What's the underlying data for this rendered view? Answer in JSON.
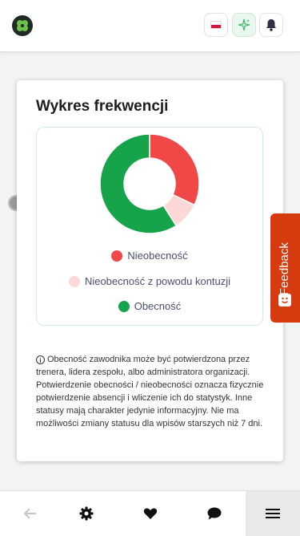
{
  "header": {
    "logo_icon": "clover-logo-icon",
    "language_icon": "poland-flag-icon",
    "ai_icon": "sparkles-icon",
    "notifications_icon": "bell-icon"
  },
  "card": {
    "title": "Wykres frekwencji",
    "chart_data": {
      "type": "pie",
      "title": "",
      "slices": [
        {
          "name": "Nieobecność",
          "value": 32,
          "color": "#f04747"
        },
        {
          "name": "Nieobecność z powodu kontuzji",
          "value": 9,
          "color": "#fcd9d6"
        },
        {
          "name": "Obecność",
          "value": 59,
          "color": "#17a34a"
        }
      ],
      "legend_position": "bottom"
    },
    "legend": [
      {
        "label": "Nieobecność",
        "color": "#f04747"
      },
      {
        "label": "Nieobecność z powodu kontuzji",
        "color": "#fcd9d6"
      },
      {
        "label": "Obecność",
        "color": "#17a34a"
      }
    ],
    "info_text": "Obecność zawodnika może być potwierdzona przez trenera, lidera zespołu, albo administratora organizacji. Potwierdzenie obecności / nieobecności oznacza fizycznie potwierdzenie absencji i wliczenie ich do statystyk. Inne statusy mają charakter jedynie informacyjny. Nie ma możliwości zmiany statusu dla wpisów starszych niż 7 dni."
  },
  "feedback": {
    "label": "Feedback"
  },
  "bottom_nav": {
    "items": [
      "back-arrow-icon",
      "settings-gear-icon",
      "heart-icon",
      "chat-bubble-icon",
      "menu-icon"
    ]
  }
}
